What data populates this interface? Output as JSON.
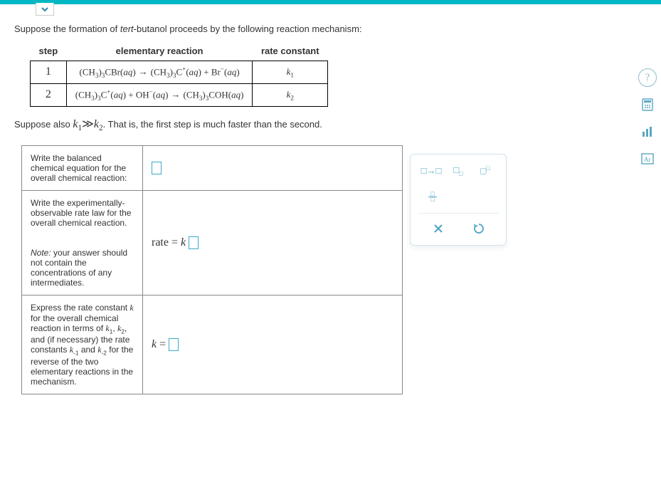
{
  "intro": {
    "pre": "Suppose the formation of ",
    "term": "tert",
    "post": "-butanol proceeds by the following reaction mechanism:"
  },
  "mech_table": {
    "headers": {
      "step": "step",
      "reaction": "elementary reaction",
      "rate": "rate constant"
    },
    "rows": [
      {
        "step": "1",
        "lhs": "(CH₃)₃CBr(aq)",
        "rhs": "(CH₃)₃C⁺(aq) + Br⁻(aq)",
        "k": "k₁"
      },
      {
        "step": "2",
        "lhs": "(CH₃)₃C⁺(aq) + OH⁻(aq)",
        "rhs": "(CH₃)₃COH(aq)",
        "k": "k₂"
      }
    ]
  },
  "suppose2": {
    "pre": "Suppose also ",
    "rel": "k₁≫k₂",
    "post": ". That is, the first step is much faster than the second."
  },
  "answers": {
    "row1": {
      "prompt": "Write the balanced chemical equation for the overall chemical reaction:"
    },
    "row2": {
      "prompt_a": "Write the experimentally-observable rate law for the overall chemical reaction.",
      "note_label": "Note:",
      "note_rest": " your answer should not contain the concentrations of any intermediates.",
      "ans_prefix": "rate = k "
    },
    "row3": {
      "prompt": "Express the rate constant k for the overall chemical reaction in terms of k₁, k₂, and (if necessary) the rate constants k₋₁ and k₋₂ for the reverse of the two elementary reactions in the mechanism.",
      "ans_prefix": "k = "
    }
  },
  "palette": {
    "arrow": "□→□",
    "sub": "□□",
    "sup": "□□",
    "frac": "□/□",
    "close": "×",
    "reset": "↺"
  },
  "tools": {
    "help": "?",
    "calc": "calculator-icon",
    "stats": "bar-chart-icon",
    "periodic": "periodic-table-icon"
  }
}
